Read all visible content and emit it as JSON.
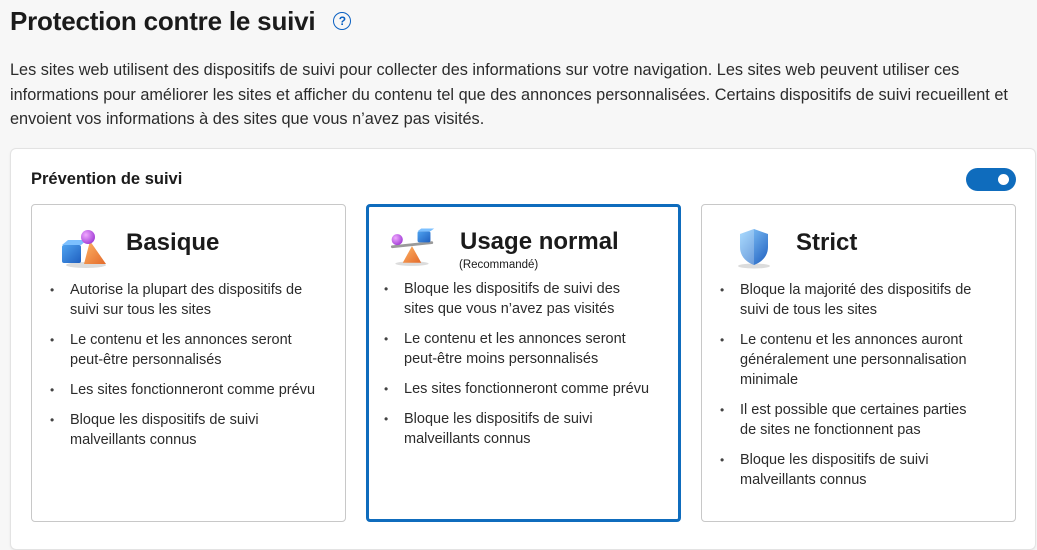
{
  "header": {
    "title": "Protection contre le suivi",
    "help_icon": "question-circle-icon"
  },
  "description": "Les sites web utilisent des dispositifs de suivi pour collecter des informations sur votre navigation. Les sites web peuvent utiliser ces informations pour améliorer les sites et afficher du contenu tel que des annonces personnalisées. Certains dispositifs de suivi recueillent et envoient vos informations à des sites que vous n’avez pas visités.",
  "prevention": {
    "label": "Prévention de suivi",
    "toggle_on": true,
    "accent_color": "#0f6cbd"
  },
  "cards": [
    {
      "title": "Basique",
      "subtitle": "",
      "icon": "shapes-icon",
      "selected": false,
      "bullets": [
        "Autorise la plupart des dispositifs de suivi sur tous les sites",
        "Le contenu et les annonces seront peut-être personnalisés",
        "Les sites fonctionneront comme prévu",
        "Bloque les dispositifs de suivi malveillants connus"
      ]
    },
    {
      "title": "Usage normal",
      "subtitle": "(Recommandé)",
      "icon": "balance-icon",
      "selected": true,
      "bullets": [
        "Bloque les dispositifs de suivi des sites que vous n’avez pas visités",
        "Le contenu et les annonces seront peut-être moins personnalisés",
        "Les sites fonctionneront comme prévu",
        "Bloque les dispositifs de suivi malveillants connus"
      ]
    },
    {
      "title": "Strict",
      "subtitle": "",
      "icon": "shield-icon",
      "selected": false,
      "bullets": [
        "Bloque la majorité des dispositifs de suivi de tous les sites",
        "Le contenu et les annonces auront généralement une personnalisation minimale",
        "Il est possible que certaines parties de sites ne fonctionnent pas",
        "Bloque les dispositifs de suivi malveillants connus"
      ]
    }
  ]
}
